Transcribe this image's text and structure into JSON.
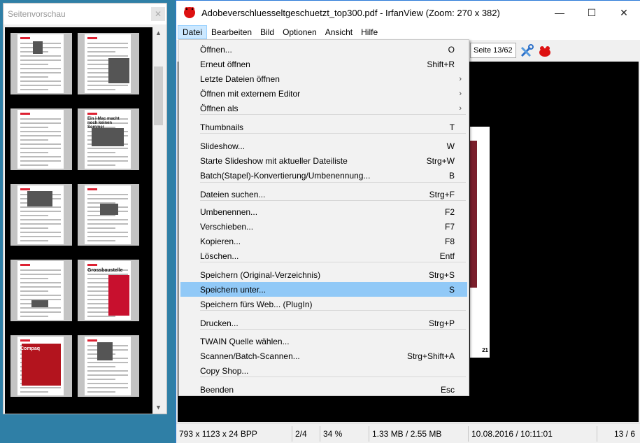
{
  "thumb_window": {
    "title": "Seitenvorschau",
    "close_icon": "close-icon",
    "pages": [
      {
        "title": ""
      },
      {
        "title": ""
      },
      {
        "title": ""
      },
      {
        "title": "Ein i-Mac macht noch keinen Sommer"
      },
      {
        "title": ""
      },
      {
        "title": ""
      },
      {
        "title": ""
      },
      {
        "title": "Grossbaustelle"
      },
      {
        "title": "Compaq"
      },
      {
        "title": ""
      }
    ]
  },
  "main_window": {
    "title": "Adobeverschluesseltgeschuetzt_top300.pdf - IrfanView (Zoom: 270 x 382)",
    "app_icon": "irfanview-icon",
    "controls": {
      "minimize": "—",
      "maximize": "☐",
      "close": "✕"
    },
    "menu": [
      "Datei",
      "Bearbeiten",
      "Bild",
      "Optionen",
      "Ansicht",
      "Hilfe"
    ],
    "active_menu": "Datei",
    "toolbar": {
      "page_indicator": "Seite 13/62",
      "tools_icon": "tools-icon",
      "frog_icon": "irfanview-frog-icon"
    },
    "page_number": "21",
    "status": {
      "dimensions": "793 x 1123 x 24 BPP",
      "index": "2/4",
      "zoom": "34 %",
      "size": "1.33 MB / 2.55 MB",
      "datetime": "10.08.2016 / 10:11:01",
      "pages": "13 / 6"
    }
  },
  "file_menu": {
    "items": [
      {
        "label": "Öffnen...",
        "shortcut": "O"
      },
      {
        "label": "Erneut öffnen",
        "shortcut": "Shift+R"
      },
      {
        "label": "Letzte Dateien öffnen",
        "shortcut": "",
        "submenu": true
      },
      {
        "label": "Öffnen mit externem Editor",
        "shortcut": "",
        "submenu": true
      },
      {
        "label": "Öffnen als",
        "shortcut": "",
        "submenu": true
      },
      {
        "label": "Thumbnails",
        "shortcut": "T"
      },
      {
        "label": "Slideshow...",
        "shortcut": "W"
      },
      {
        "label": "Starte Slideshow mit aktueller Dateiliste",
        "shortcut": "Strg+W"
      },
      {
        "label": "Batch(Stapel)-Konvertierung/Umbenennung...",
        "shortcut": "B"
      },
      {
        "label": "Dateien suchen...",
        "shortcut": "Strg+F"
      },
      {
        "label": "Umbenennen...",
        "shortcut": "F2"
      },
      {
        "label": "Verschieben...",
        "shortcut": "F7"
      },
      {
        "label": "Kopieren...",
        "shortcut": "F8"
      },
      {
        "label": "Löschen...",
        "shortcut": "Entf"
      },
      {
        "label": "Speichern (Original-Verzeichnis)",
        "shortcut": "Strg+S"
      },
      {
        "label": "Speichern unter...",
        "shortcut": "S",
        "highlighted": true
      },
      {
        "label": "Speichern fürs Web... (PlugIn)",
        "shortcut": ""
      },
      {
        "label": "Drucken...",
        "shortcut": "Strg+P"
      },
      {
        "label": "TWAIN Quelle wählen...",
        "shortcut": ""
      },
      {
        "label": "Scannen/Batch-Scannen...",
        "shortcut": "Strg+Shift+A"
      },
      {
        "label": "Copy Shop...",
        "shortcut": ""
      },
      {
        "label": "Beenden",
        "shortcut": "Esc"
      }
    ],
    "submenu_arrow": "›"
  },
  "colors": {
    "desktop": "#2f7fa6",
    "highlight": "#91c9f7",
    "menu_active": "#cce8ff",
    "window_border": "#2b79d8"
  }
}
